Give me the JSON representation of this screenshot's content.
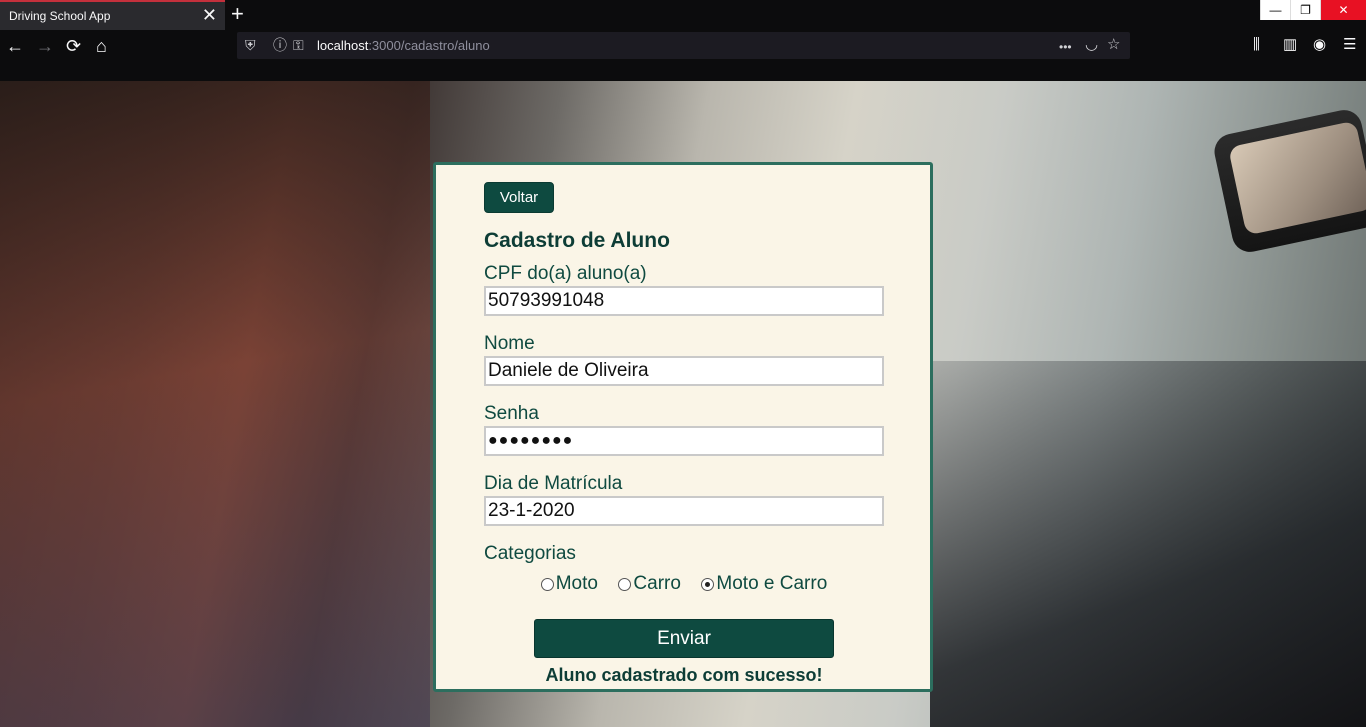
{
  "browser": {
    "tab_title": "Driving School App",
    "tab_close": "✕",
    "new_tab": "+",
    "url_host": "localhost",
    "url_path": ":3000/cadastro/aluno",
    "window_controls": {
      "minimize": "—",
      "restore": "❐",
      "close": "✕"
    },
    "nav_icons": {
      "back": "←",
      "forward": "→",
      "reload": "⟳",
      "home": "⌂"
    },
    "url_icons": {
      "shield": "⛨",
      "info": "ⓘ",
      "key": "⚿",
      "more": "•••",
      "pocket": "◡",
      "bookmark": "☆"
    },
    "toolbar_icons": {
      "library": "⫼",
      "sidebar": "▥",
      "account": "◉",
      "menu": "☰"
    }
  },
  "form": {
    "back_label": "Voltar",
    "title": "Cadastro de Aluno",
    "cpf_label": "CPF do(a) aluno(a)",
    "cpf_value": "50793991048",
    "nome_label": "Nome",
    "nome_value": "Daniele de Oliveira",
    "senha_label": "Senha",
    "senha_value": "●●●●●●●●",
    "matricula_label": "Dia de Matrícula",
    "matricula_value": "23-1-2020",
    "categorias_label": "Categorias",
    "categorias": [
      {
        "label": "Moto",
        "checked": false
      },
      {
        "label": "Carro",
        "checked": false
      },
      {
        "label": "Moto e Carro",
        "checked": true
      }
    ],
    "submit_label": "Enviar",
    "success_message": "Aluno cadastrado com sucesso!"
  },
  "colors": {
    "primary": "#0e4a40",
    "card_bg": "#faf5e7",
    "card_border": "#2c6e5e",
    "tab_accent": "#c4303c"
  }
}
